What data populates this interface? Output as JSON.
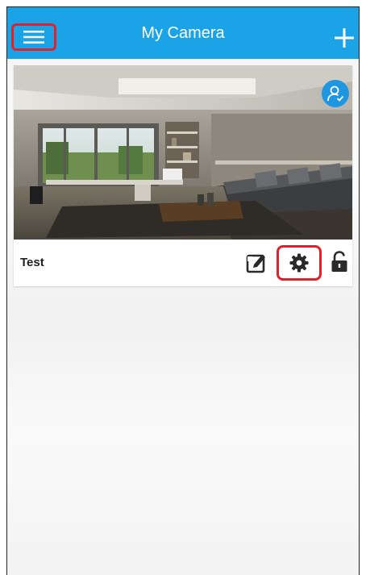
{
  "header": {
    "title": "My Camera",
    "menu_icon": "hamburger-menu-icon",
    "add_icon": "plus-icon",
    "background_color": "#1aa3e6",
    "highlight_color": "#e3202a"
  },
  "camera_list": [
    {
      "name": "Test",
      "preview": "living-room-camera-snapshot",
      "share_icon": "user-share-icon",
      "actions": [
        {
          "icon": "edit-icon"
        },
        {
          "icon": "gear-icon",
          "highlighted": true
        },
        {
          "icon": "unlock-icon"
        }
      ]
    }
  ]
}
